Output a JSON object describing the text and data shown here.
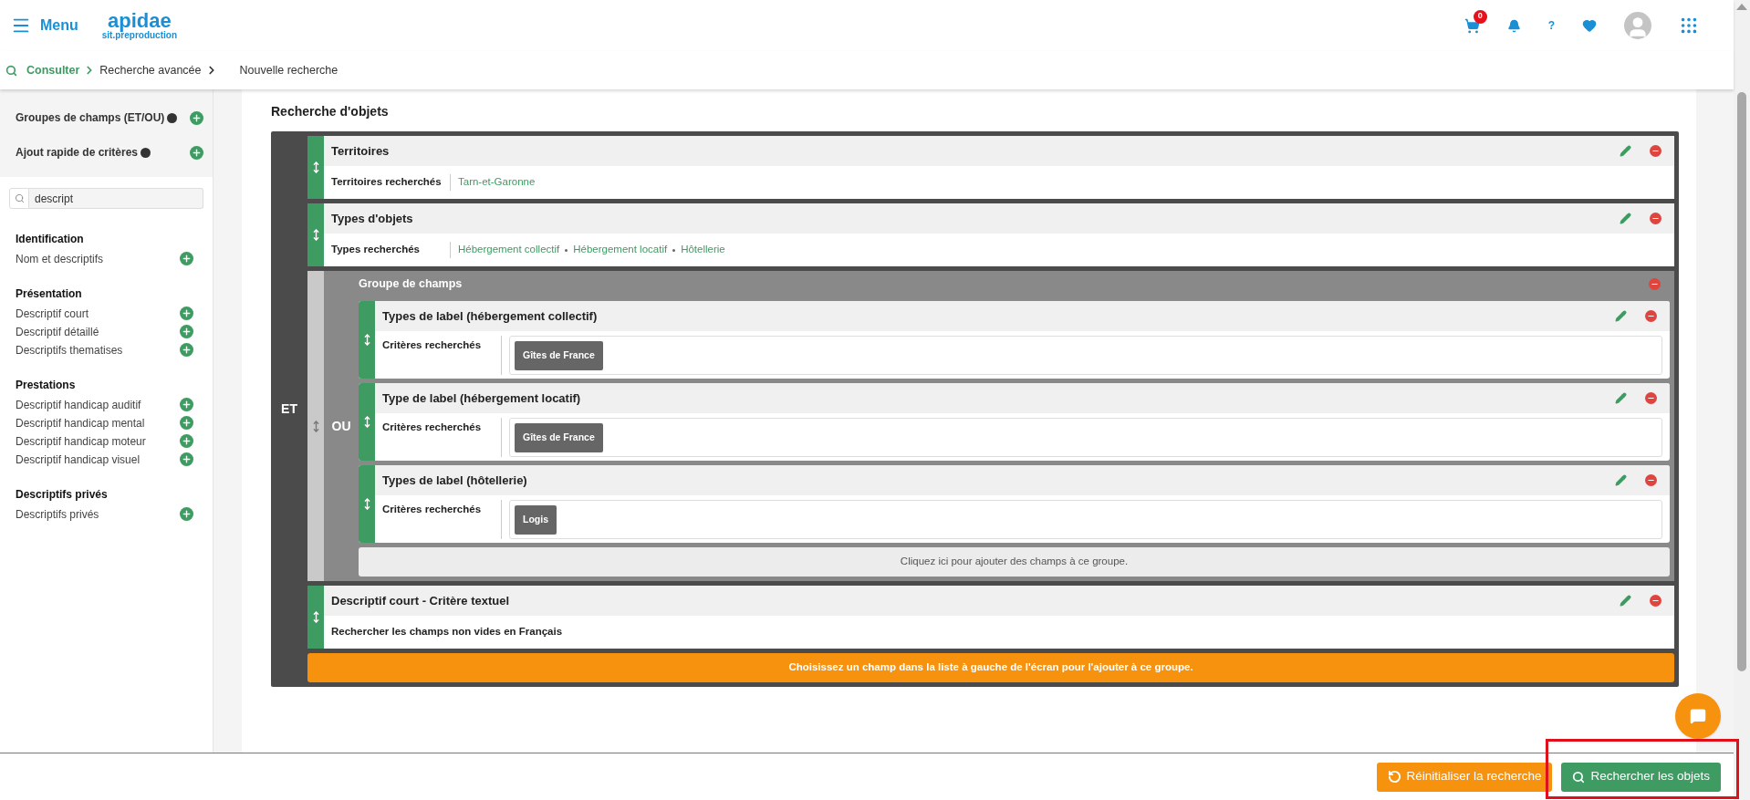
{
  "header": {
    "menu_label": "Menu",
    "logo": "apidae",
    "logo_subtitle": "sit.preproduction",
    "cart_count": "0",
    "help": "?"
  },
  "breadcrumb": {
    "links": [
      {
        "label": "Consulter",
        "kind": "home"
      },
      {
        "label": "Recherche avancée",
        "kind": "crumb"
      }
    ],
    "current": "Nouvelle recherche"
  },
  "sidebar": {
    "actions": [
      {
        "label": "Groupes de champs (ET/OU)"
      },
      {
        "label": "Ajout rapide de critères"
      }
    ],
    "search": {
      "value": "descript"
    },
    "sections": [
      {
        "title": "Identification",
        "items": [
          "Nom et descriptifs"
        ]
      },
      {
        "title": "Présentation",
        "items": [
          "Descriptif court",
          "Descriptif détaillé",
          "Descriptifs thematises"
        ]
      },
      {
        "title": "Prestations",
        "items": [
          "Descriptif handicap auditif",
          "Descriptif handicap mental",
          "Descriptif handicap moteur",
          "Descriptif handicap visuel"
        ]
      },
      {
        "title": "Descriptifs privés",
        "items": [
          "Descriptifs privés"
        ]
      }
    ]
  },
  "main": {
    "title": "Recherche d'objets",
    "operator": "ET",
    "blocks": [
      {
        "kind": "field",
        "title": "Territoires",
        "label": "Territoires recherchés",
        "values": [
          "Tarn-et-Garonne"
        ]
      },
      {
        "kind": "field",
        "title": "Types d'objets",
        "label": "Types recherchés",
        "values": [
          "Hébergement collectif",
          "Hébergement locatif",
          "Hôtellerie"
        ]
      },
      {
        "kind": "group",
        "title": "Groupe de champs",
        "operator": "OU",
        "add_hint": "Cliquez ici pour ajouter des champs à ce groupe.",
        "fields": [
          {
            "title": "Types de label (hébergement collectif)",
            "label": "Critères recherchés",
            "tags": [
              "Gîtes de France"
            ]
          },
          {
            "title": "Type de label (hébergement locatif)",
            "label": "Critères recherchés",
            "tags": [
              "Gîtes de France"
            ]
          },
          {
            "title": "Types de label (hôtellerie)",
            "label": "Critères recherchés",
            "tags": [
              "Logis"
            ]
          }
        ]
      },
      {
        "kind": "text",
        "title": "Descriptif court - Critère textuel",
        "text": "Rechercher les champs non vides en Français"
      }
    ],
    "add_hint": "Choisissez un champ dans la liste à gauche de l'écran pour l'ajouter à ce groupe."
  },
  "footer": {
    "reset": "Réinitialiser la recherche",
    "search": "Rechercher les objets"
  }
}
